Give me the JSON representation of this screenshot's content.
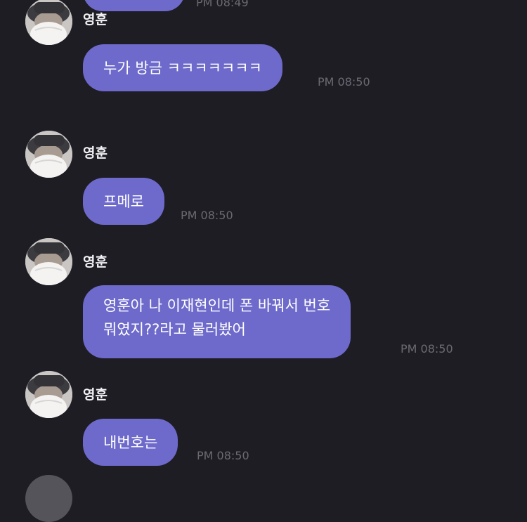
{
  "messages": [
    {
      "sender": "영훈",
      "text": "누가 방금 ㅋㅋㅋㅋㅋㅋㅋ",
      "time": "PM 08:50"
    },
    {
      "sender": "영훈",
      "text": "프메로",
      "time": "PM 08:50"
    },
    {
      "sender": "영훈",
      "text_line1": "영훈아 나 이재현인데 폰 바꿔서 번호",
      "text_line2": "뭐였지??라고 물러봤어",
      "time": "PM 08:50"
    },
    {
      "sender": "영훈",
      "text": "내번호는",
      "time": "PM 08:50"
    }
  ],
  "previous_message_time": "PM 08:49",
  "colors": {
    "background": "#1e1d24",
    "bubble": "#6e6acb",
    "text": "#ffffff",
    "time": "#6a6a72"
  },
  "icons": {
    "avatar": "profile-photo-icon"
  }
}
